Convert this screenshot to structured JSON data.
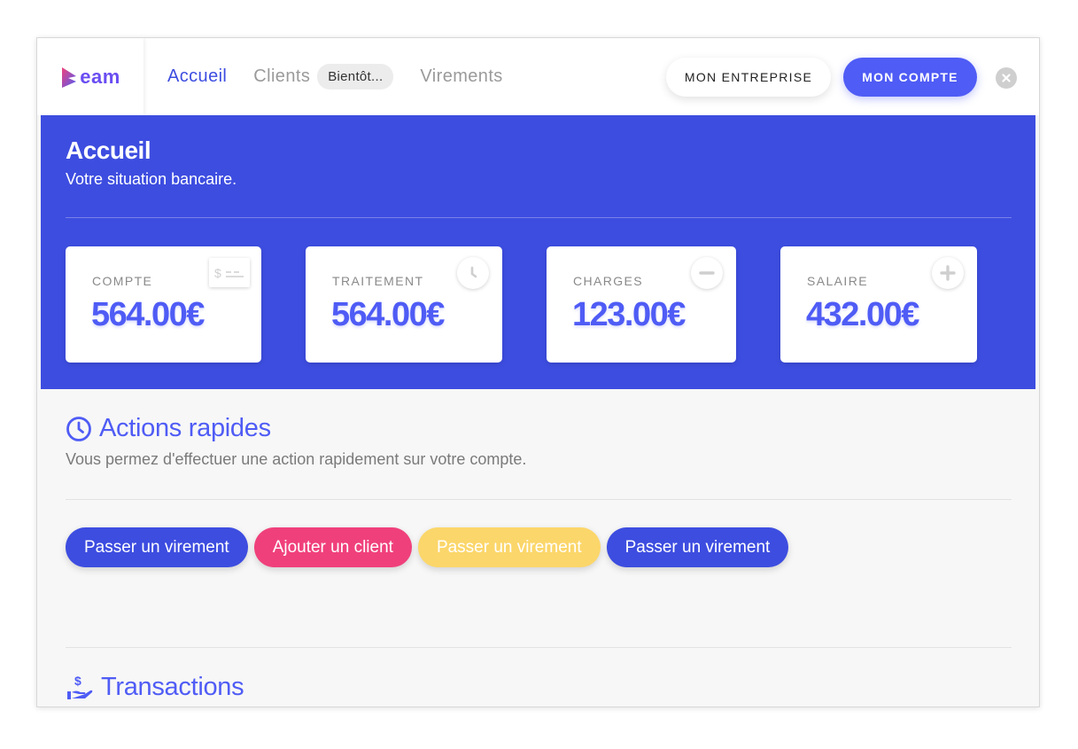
{
  "app": {
    "logo_text": "eam",
    "logo_icon": "play-logo-icon"
  },
  "nav": {
    "items": [
      {
        "label": "Accueil",
        "active": true
      },
      {
        "label": "Clients",
        "badge": "Bientôt..."
      },
      {
        "label": "Virements"
      }
    ]
  },
  "header_buttons": {
    "company": "MON ENTREPRISE",
    "account": "MON COMPTE",
    "close_icon": "close-icon"
  },
  "hero": {
    "title": "Accueil",
    "subtitle": "Votre situation bancaire."
  },
  "cards": [
    {
      "label": "COMPTE",
      "value": "564.00€",
      "icon": "check-card-icon"
    },
    {
      "label": "TRAITEMENT",
      "value": "564.00€",
      "icon": "clock-icon"
    },
    {
      "label": "CHARGES",
      "value": "123.00€",
      "icon": "minus-icon"
    },
    {
      "label": "SALAIRE",
      "value": "432.00€",
      "icon": "plus-icon"
    }
  ],
  "quick_actions": {
    "title": "Actions rapides",
    "subtitle": "Vous permez d'effectuer une action rapidement sur votre compte.",
    "buttons": [
      {
        "label": "Passer un virement",
        "color": "#3d4de0"
      },
      {
        "label": "Ajouter un client",
        "color": "#f0407b"
      },
      {
        "label": "Passer un virement",
        "color": "#fbd66a"
      },
      {
        "label": "Passer un virement",
        "color": "#3d4de0"
      }
    ]
  },
  "transactions": {
    "title": "Transactions"
  },
  "colors": {
    "primary": "#3d4de0",
    "accent": "#4f5cf5",
    "pink": "#f0407b",
    "yellow": "#fbd66a"
  }
}
